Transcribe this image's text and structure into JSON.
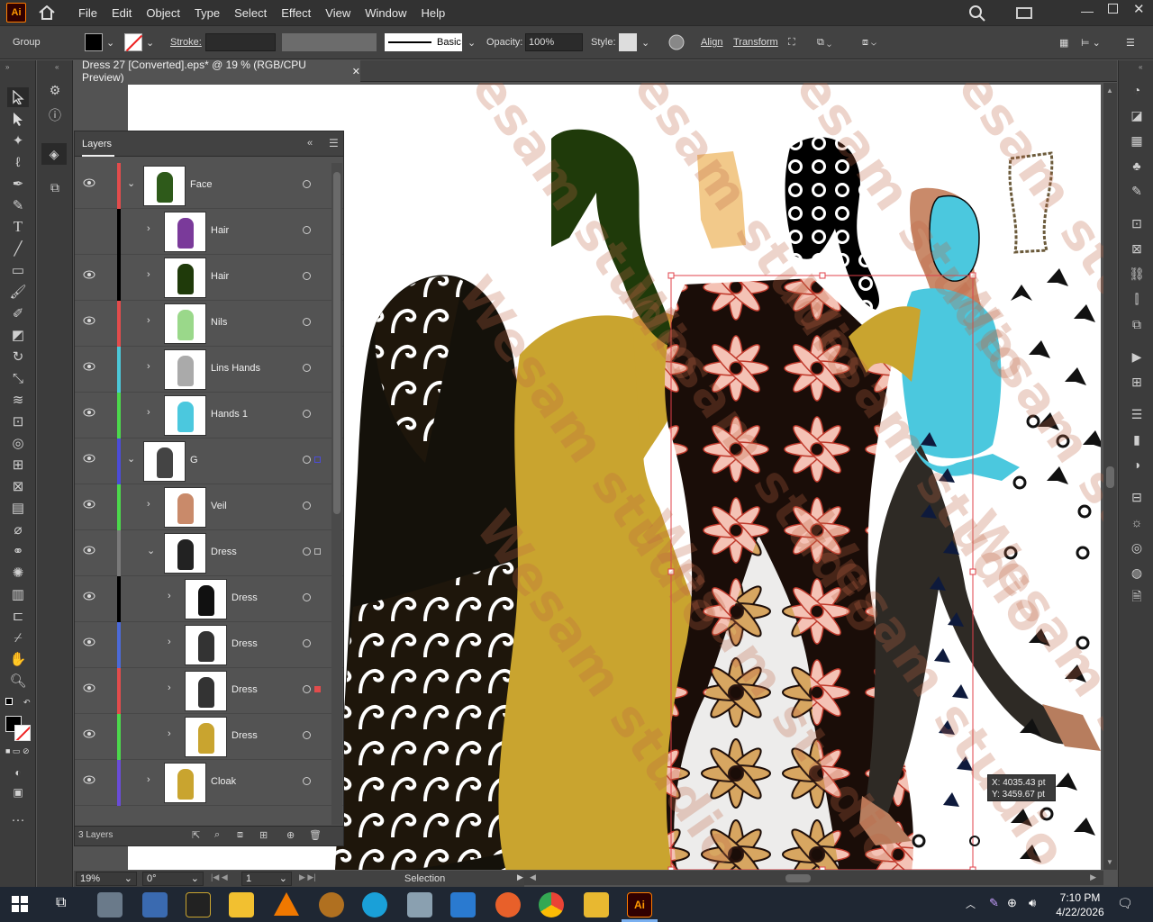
{
  "menubar": {
    "logo": "Ai",
    "items": [
      "File",
      "Edit",
      "Object",
      "Type",
      "Select",
      "Effect",
      "View",
      "Window",
      "Help"
    ]
  },
  "control_bar": {
    "selection_type": "Group",
    "stroke_label": "Stroke:",
    "brush_label": "Basic",
    "opacity_label": "Opacity:",
    "opacity_value": "100%",
    "style_label": "Style:",
    "align_label": "Align",
    "transform_label": "Transform"
  },
  "document": {
    "tab_title": "Dress 27 [Converted].eps* @ 19 % (RGB/CPU Preview)"
  },
  "layers_panel": {
    "title": "Layers",
    "rows": [
      {
        "name": "Face",
        "visible": true,
        "color": "#e24c4c",
        "expanded": true,
        "depth": 0
      },
      {
        "name": "Hair",
        "visible": false,
        "color": "#000000",
        "expanded": false,
        "depth": 1
      },
      {
        "name": "Hair",
        "visible": true,
        "color": "#000000",
        "expanded": false,
        "depth": 1
      },
      {
        "name": "Nils",
        "visible": true,
        "color": "#e24c4c",
        "expanded": false,
        "depth": 1
      },
      {
        "name": "Lins Hands",
        "visible": true,
        "color": "#4cc8d8",
        "expanded": false,
        "depth": 1
      },
      {
        "name": "Hands 1",
        "visible": true,
        "color": "#4cd84c",
        "expanded": false,
        "depth": 1
      },
      {
        "name": "G",
        "visible": true,
        "color": "#4c4cd8",
        "expanded": true,
        "depth": 0
      },
      {
        "name": "Veil",
        "visible": true,
        "color": "#4cd84c",
        "expanded": false,
        "depth": 1
      },
      {
        "name": "Dress",
        "visible": true,
        "color": "#7a7a7a",
        "expanded": true,
        "depth": 1
      },
      {
        "name": "Dress",
        "visible": true,
        "color": "#000000",
        "expanded": false,
        "depth": 2
      },
      {
        "name": "Dress",
        "visible": true,
        "color": "#4c6ad8",
        "expanded": false,
        "depth": 2
      },
      {
        "name": "Dress",
        "visible": true,
        "color": "#e24c4c",
        "expanded": false,
        "depth": 2
      },
      {
        "name": "Dress",
        "visible": true,
        "color": "#4cd84c",
        "expanded": false,
        "depth": 2
      },
      {
        "name": "Cloak",
        "visible": true,
        "color": "#6a4cd8",
        "expanded": false,
        "depth": 1
      }
    ],
    "footer": "3 Layers"
  },
  "cursor_readout": {
    "x": "X: 4035.43 pt",
    "y": "Y: 3459.67 pt"
  },
  "watermark": "Wesam studio",
  "status_bar": {
    "zoom": "19%",
    "rotate": "0°",
    "artboard": "1",
    "tool": "Selection"
  },
  "taskbar": {
    "time": "7:10 PM",
    "date": "4/22/2026"
  }
}
